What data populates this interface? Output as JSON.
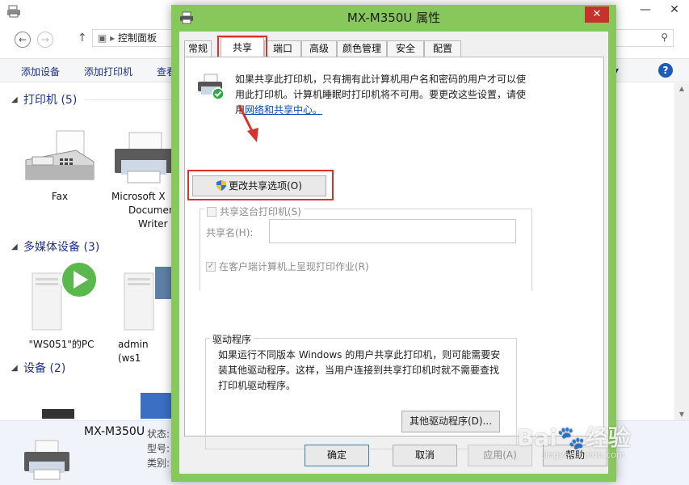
{
  "explorer": {
    "nav": {
      "back": "←",
      "forward": "→",
      "up": "↑",
      "address": "控制面板"
    },
    "commands": [
      "添加设备",
      "添加打印机",
      "查看"
    ],
    "sections": {
      "printers": "打印机 (5)",
      "multimedia": "多媒体设备 (3)",
      "devices": "设备 (2)"
    },
    "printers": [
      {
        "label": "Fax"
      },
      {
        "label_line1": "Microsoft X",
        "label_line2": "Documen",
        "label_line3": "Writer"
      }
    ],
    "multimedia": [
      {
        "label": "\"WS051\"的PC"
      },
      {
        "label": "admin (ws1"
      }
    ],
    "status_bar": {
      "name": "MX-M350U",
      "state_label": "状态:",
      "model_label": "型号:",
      "category_label": "类别:"
    }
  },
  "dialog": {
    "title": "MX-M350U 属性",
    "close": "✕",
    "tabs": [
      "常规",
      "共享",
      "端口",
      "高级",
      "颜色管理",
      "安全",
      "配置"
    ],
    "active_tab": "共享",
    "intro_line1": "如果共享此打印机，只有拥有此计算机用户名和密码的用户才可以使",
    "intro_line2": "用此打印机。计算机睡眠时打印机将不可用。要更改这些设置，请使",
    "intro_line3_prefix": "用",
    "intro_link": "网络和共享中心。",
    "change_sharing_button": "更改共享选项(O)",
    "share_checkbox_label": "共享这台打印机(S)",
    "share_name_label": "共享名(H):",
    "share_name_value": "",
    "render_jobs_label": "在客户端计算机上呈现打印作业(R)",
    "drivers_legend": "驱动程序",
    "drivers_text_line1": "如果运行不同版本 Windows 的用户共享此打印机，则可能需要安",
    "drivers_text_line2": "装其他驱动程序。这样，当用户连接到共享打印机时就不需要查找",
    "drivers_text_line3": "打印机驱动程序。",
    "other_drivers_button": "其他驱动程序(D)...",
    "buttons": {
      "ok": "确定",
      "cancel": "取消",
      "apply": "应用(A)",
      "help": "帮助"
    }
  },
  "watermark": {
    "main": "Bai🐾经验",
    "sub": "jingyan.baidu.com"
  },
  "colors": {
    "dialog_frame": "#87c75c",
    "close": "#c7302b",
    "highlight": "#d8322d",
    "link": "#0a48b8"
  }
}
